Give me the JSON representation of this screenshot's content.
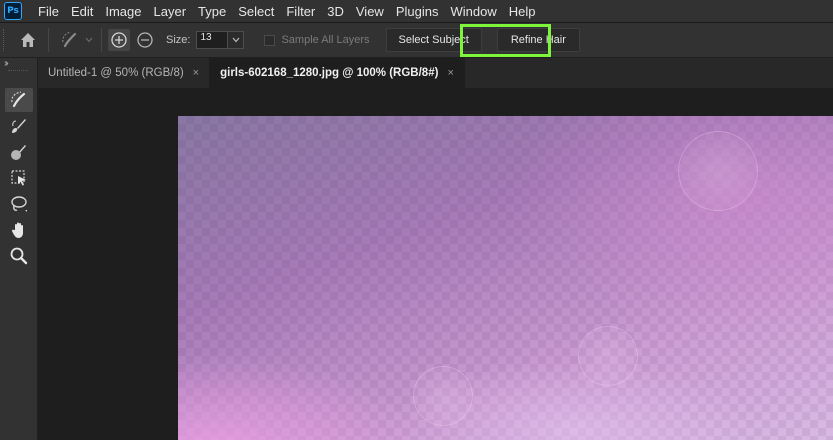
{
  "app": {
    "logo": "Ps"
  },
  "menu": {
    "items": [
      "File",
      "Edit",
      "Image",
      "Layer",
      "Type",
      "Select",
      "Filter",
      "3D",
      "View",
      "Plugins",
      "Window",
      "Help"
    ]
  },
  "options": {
    "size_label": "Size:",
    "size_value": "13",
    "sample_all_layers_label": "Sample All Layers",
    "select_subject_label": "Select Subject",
    "refine_hair_label": "Refine Hair",
    "highlight_color": "#7cf53a"
  },
  "tabs": [
    {
      "label": "Untitled-1 @ 50% (RGB/8)",
      "close": "×",
      "active": false
    },
    {
      "label": "girls-602168_1280.jpg @ 100% (RGB/8#)",
      "close": "×",
      "active": true
    }
  ],
  "toolbar": {
    "collapse_glyph": "››",
    "tools": [
      "quick-selection-icon",
      "brush-icon",
      "eraser-brush-icon",
      "object-selection-icon",
      "lasso-icon",
      "hand-icon",
      "zoom-icon"
    ]
  }
}
